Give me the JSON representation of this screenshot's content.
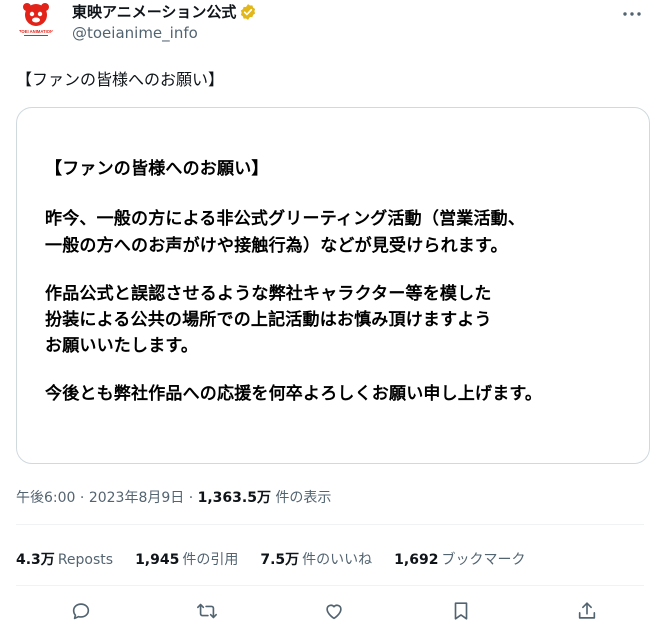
{
  "account": {
    "display_name": "東映アニメーション公式",
    "handle": "@toeianime_info",
    "avatar_text": "TOEI ANIMATION"
  },
  "tweet": {
    "text": "【ファンの皆様へのお願い】"
  },
  "media": {
    "lines": [
      "【ファンの皆様へのお願い】",
      "昨今、一般の方による非公式グリーティング活動（営業活動、",
      "一般の方へのお声がけや接触行為）などが見受けられます。",
      "作品公式と誤認させるような弊社キャラクター等を模した",
      "扮装による公共の場所での上記活動はお慎み頂けますよう",
      "お願いいたします。",
      "今後とも弊社作品への応援を何卒よろしくお願い申し上げます。"
    ]
  },
  "meta": {
    "time": "午後6:00",
    "date": "2023年8月9日",
    "views_count": "1,363.5万",
    "views_label": "件の表示",
    "separator": "·"
  },
  "stats": [
    {
      "num": "4.3万",
      "label": "Reposts"
    },
    {
      "num": "1,945",
      "label": "件の引用"
    },
    {
      "num": "7.5万",
      "label": "件のいいね"
    },
    {
      "num": "1,692",
      "label": "ブックマーク"
    }
  ],
  "colors": {
    "verified_badge": "#e2b719",
    "avatar_red": "#e2231a",
    "secondary_text": "#536471",
    "border": "#cfd9de"
  },
  "icons": [
    "reply-icon",
    "repost-icon",
    "like-icon",
    "bookmark-icon",
    "share-icon",
    "more-icon",
    "verified-badge-icon"
  ]
}
